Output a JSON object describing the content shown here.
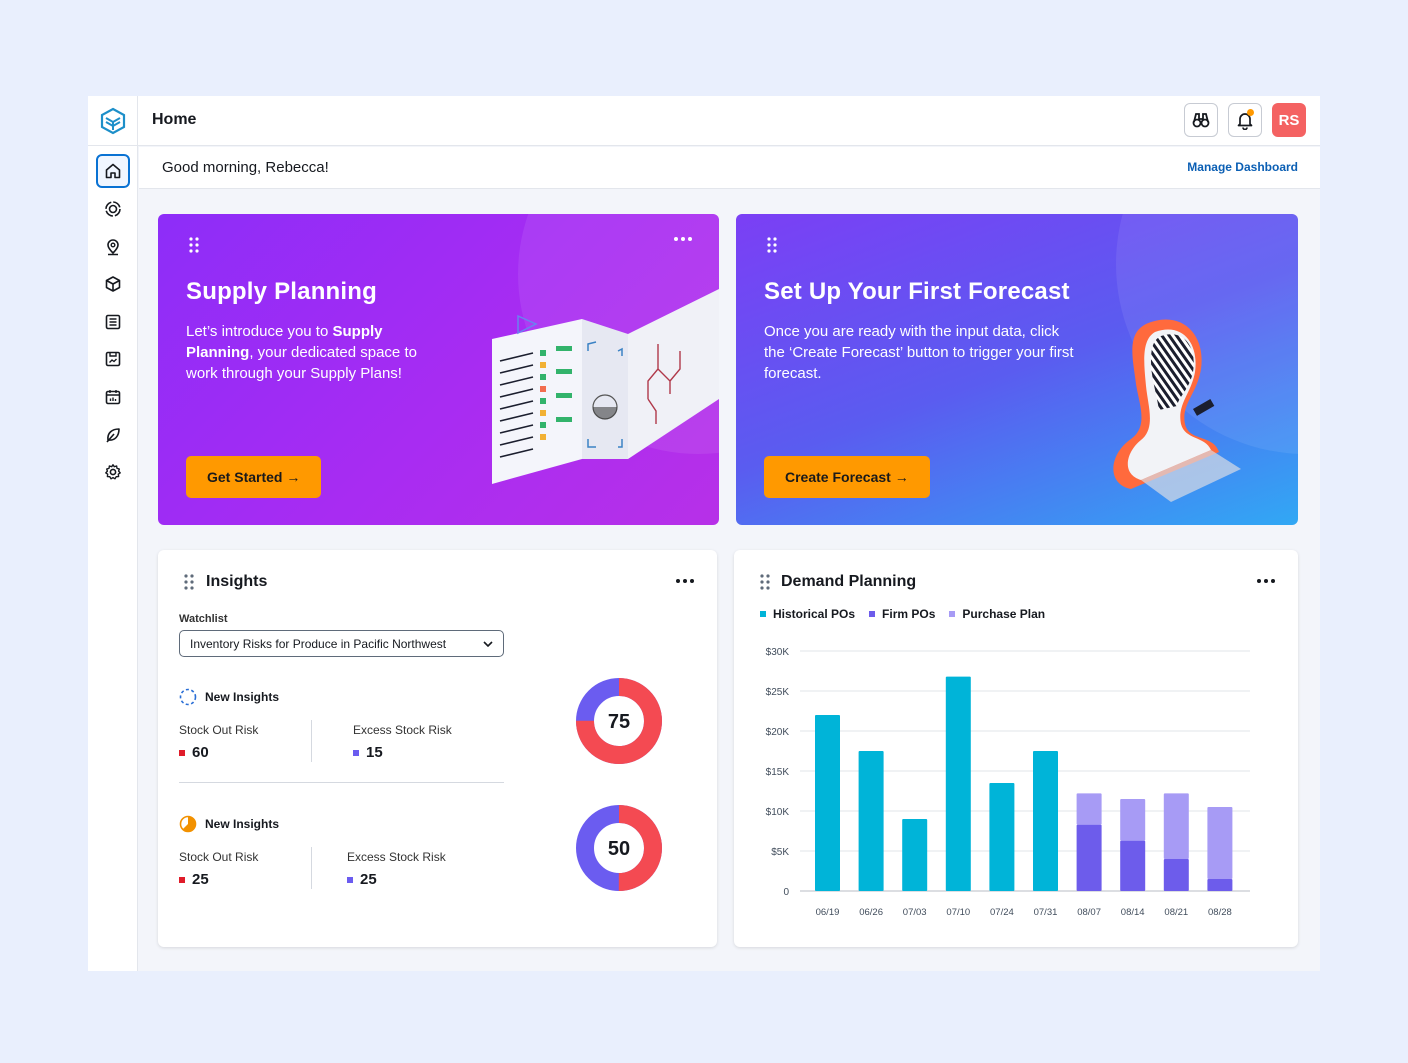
{
  "header": {
    "title": "Home",
    "avatar_initials": "RS"
  },
  "greeting": {
    "text": "Good morning, Rebecca!",
    "manage_label": "Manage Dashboard"
  },
  "sidebar": {
    "items": [
      "home-icon",
      "target-icon",
      "location-pin-icon",
      "box-icon",
      "list-icon",
      "report-icon",
      "calendar-chart-icon",
      "leaf-icon",
      "settings-gear-icon"
    ]
  },
  "hero_supply": {
    "title": "Supply Planning",
    "text_1": "Let’s introduce you to ",
    "text_bold_1": "Supply Planning",
    "text_2": ", your dedicated space to work through your Supply Plans!",
    "cta": "Get Started →"
  },
  "hero_forecast": {
    "title": "Set Up Your First Forecast",
    "text": "Once you are ready with the input data, click the ‘Create Forecast’ button to trigger your first forecast.",
    "cta": "Create Forecast →"
  },
  "insights": {
    "title": "Insights",
    "watchlist_label": "Watchlist",
    "watchlist_value": "Inventory Risks for Produce in Pacific Northwest",
    "groups": [
      {
        "heading": "New Insights",
        "stock_out_label": "Stock Out Risk",
        "stock_out_value": "60",
        "excess_label": "Excess Stock Risk",
        "excess_value": "15",
        "total": "75",
        "stock_out_fraction": 0.75
      },
      {
        "heading": "New Insights",
        "stock_out_label": "Stock Out Risk",
        "stock_out_value": "25",
        "excess_label": "Excess Stock Risk",
        "excess_value": "25",
        "total": "50",
        "stock_out_fraction": 0.5
      }
    ],
    "colors": {
      "stock_out": "#f44a52",
      "excess": "#6b5cf0"
    }
  },
  "demand": {
    "title": "Demand Planning",
    "chart_data": {
      "type": "bar",
      "stacked": true,
      "categories": [
        "06/19",
        "06/26",
        "07/03",
        "07/10",
        "07/24",
        "07/31",
        "08/07",
        "08/14",
        "08/21",
        "08/28"
      ],
      "series": [
        {
          "name": "Historical POs",
          "color": "#00b4d8",
          "values": [
            22000,
            17500,
            9000,
            26800,
            13500,
            17500,
            0,
            0,
            0,
            0
          ]
        },
        {
          "name": "Firm POs",
          "color": "#6d5ceb",
          "values": [
            0,
            0,
            0,
            0,
            0,
            0,
            8300,
            6300,
            4000,
            1500
          ]
        },
        {
          "name": "Purchase Plan",
          "color": "#a79bf5",
          "values": [
            0,
            0,
            0,
            0,
            0,
            0,
            3900,
            5200,
            8200,
            9000
          ]
        }
      ],
      "y_ticks": [
        "0",
        "$5K",
        "$10K",
        "$15K",
        "$20K",
        "$25K",
        "$30K"
      ],
      "ylim": [
        0,
        30000
      ],
      "grid": true,
      "legend": "top-left"
    }
  }
}
